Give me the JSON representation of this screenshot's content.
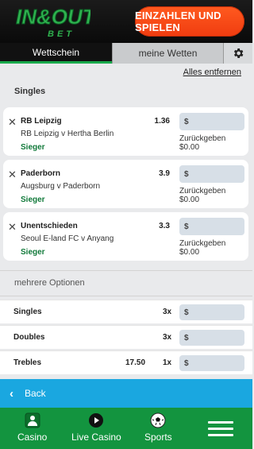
{
  "header": {
    "brand_line1": "IN&OUT",
    "brand_line2": "BET",
    "deposit_label": "EINZAHLEN UND SPIELEN"
  },
  "tabs": [
    {
      "label": "Wettschein"
    },
    {
      "label": "meine Wetten"
    }
  ],
  "remove_all_label": "Alles entfernen",
  "singles_section_title": "Singles",
  "bets": [
    {
      "selection": "RB Leipzig",
      "odds": "1.36",
      "match": "RB Leipzig v Hertha Berlin",
      "market": "Sieger",
      "stake_placeholder": "$",
      "return_label": "Zurückgeben",
      "return_value": "$0.00"
    },
    {
      "selection": "Paderborn",
      "odds": "3.9",
      "match": "Augsburg v Paderborn",
      "market": "Sieger",
      "stake_placeholder": "$",
      "return_label": "Zurückgeben",
      "return_value": "$0.00"
    },
    {
      "selection": "Unentschieden",
      "odds": "3.3",
      "match": "Seoul E-land FC v Anyang",
      "market": "Sieger",
      "stake_placeholder": "$",
      "return_label": "Zurückgeben",
      "return_value": "$0.00"
    }
  ],
  "multi_section_title": "mehrere Optionen",
  "multiples": [
    {
      "name": "Singles",
      "odds": "",
      "multiplier": "3x",
      "stake_placeholder": "$"
    },
    {
      "name": "Doubles",
      "odds": "",
      "multiplier": "3x",
      "stake_placeholder": "$"
    },
    {
      "name": "Trebles",
      "odds": "17.50",
      "multiplier": "1x",
      "stake_placeholder": "$"
    }
  ],
  "back_label": "Back",
  "bottom_nav": [
    {
      "label": "Casino",
      "icon": "casino-icon"
    },
    {
      "label": "Live Casino",
      "icon": "play-icon"
    },
    {
      "label": "Sports",
      "icon": "football-icon"
    }
  ],
  "colors": {
    "accent_green": "#19a94b",
    "deposit_orange": "#f24a15",
    "back_blue": "#1aa7e0",
    "nav_green": "#13943f",
    "market_green": "#127a3b"
  }
}
